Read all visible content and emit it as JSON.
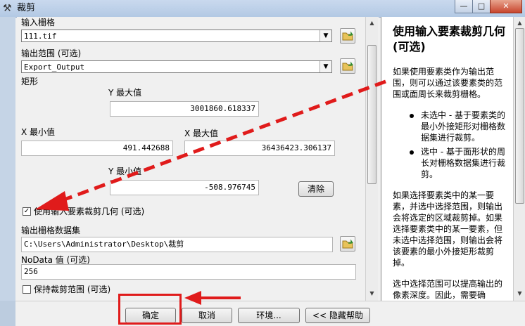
{
  "window": {
    "title": "裁剪",
    "controls": [
      "—",
      "□",
      "✕"
    ]
  },
  "form": {
    "input_raster_label": "输入栅格",
    "input_raster_value": "111.tif",
    "output_extent_label": "输出范围 (可选)",
    "output_extent_value": "Export_Output",
    "rectangle_label": "矩形",
    "ymax_label": "Y 最大值",
    "ymax_value": "3001860.618337",
    "xmin_label": "X 最小值",
    "xmin_value": "491.442688",
    "xmax_label": "X 最大值",
    "xmax_value": "36436423.306137",
    "ymin_label": "Y 最小值",
    "ymin_value": "-508.976745",
    "clear_button": "清除",
    "use_feature_label": "使用输入要素裁剪几何 (可选)",
    "use_feature_checked": true,
    "output_raster_label": "输出栅格数据集",
    "output_raster_value": "C:\\Users\\Administrator\\Desktop\\裁剪",
    "nodata_label": "NoData 值 (可选)",
    "nodata_value": "256",
    "keep_extent_label": "保持裁剪范围 (可选)",
    "keep_extent_checked": false
  },
  "help": {
    "title": "使用输入要素裁剪几何 (可选)",
    "p1": "如果使用要素类作为输出范围，则可以通过该要素类的范围或面周长来裁剪栅格。",
    "b1": "未选中 - 基于要素类的最小外接矩形对栅格数据集进行裁剪。",
    "b2": "选中 - 基于面形状的周长对栅格数据集进行裁剪。",
    "p2": "如果选择要素类中的某一要素，并选中选择范围，则输出会将选定的区域裁剪掉。如果选择要素类中的某一要素，但未选中选择范围，则输出会将该要素的最小外接矩形裁剪掉。",
    "p3": "选中选择范围可以提高输出的像素深度。因此，需要确"
  },
  "footer": {
    "ok": "确定",
    "cancel": "取消",
    "environments": "环境...",
    "hide_help": "<< 隐藏帮助"
  },
  "colors": {
    "annotation_red": "#e01b1b",
    "help_bg": "#ffffff"
  }
}
